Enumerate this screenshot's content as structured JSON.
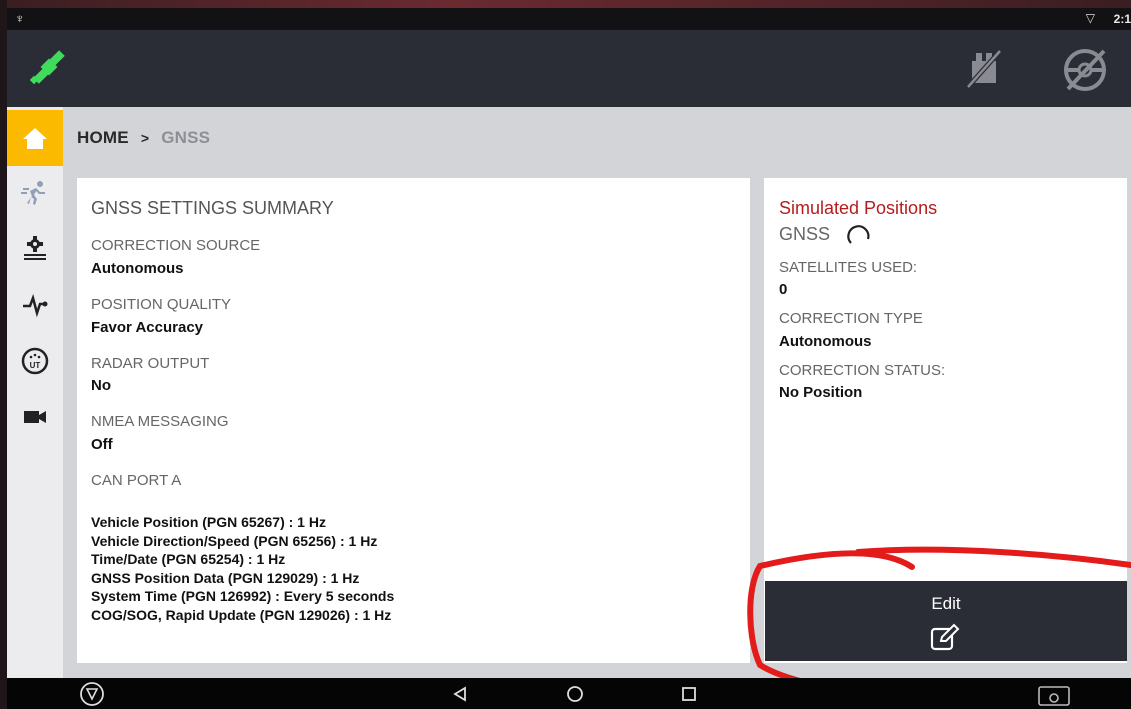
{
  "status_bar": {
    "time": "2:1"
  },
  "breadcrumb": {
    "home": "HOME",
    "separator": ">",
    "current": "GNSS"
  },
  "sidebar": {
    "items": [
      {
        "icon": "home-icon",
        "active": true
      },
      {
        "icon": "runner-icon",
        "active": false
      },
      {
        "icon": "field-gear-icon",
        "active": false
      },
      {
        "icon": "pulse-icon",
        "active": false
      },
      {
        "icon": "ut-icon",
        "active": false
      },
      {
        "icon": "camera-icon",
        "active": false
      }
    ]
  },
  "summary": {
    "title": "GNSS SETTINGS SUMMARY",
    "fields": [
      {
        "label": "CORRECTION SOURCE",
        "value": "Autonomous"
      },
      {
        "label": "POSITION QUALITY",
        "value": "Favor Accuracy"
      },
      {
        "label": "RADAR OUTPUT",
        "value": "No"
      },
      {
        "label": "NMEA MESSAGING",
        "value": "Off"
      }
    ],
    "can_port_label": "CAN PORT A",
    "can_messages": [
      "Vehicle Position (PGN 65267) : 1 Hz",
      "Vehicle Direction/Speed (PGN 65256) : 1 Hz",
      "Time/Date (PGN 65254) : 1 Hz",
      "GNSS Position Data (PGN 129029) : 1 Hz",
      "System Time (PGN 126992) : Every 5 seconds",
      "COG/SOG, Rapid Update (PGN 129026) : 1 Hz"
    ]
  },
  "status_panel": {
    "title": "Simulated Positions",
    "subtitle": "GNSS",
    "fields": [
      {
        "label": "SATELLITES USED:",
        "value": "0"
      },
      {
        "label": "CORRECTION TYPE",
        "value": "Autonomous"
      },
      {
        "label": "CORRECTION STATUS:",
        "value": "No Position"
      }
    ]
  },
  "edit_button": {
    "label": "Edit"
  },
  "colors": {
    "accent": "#fbb900",
    "header": "#2a2c36",
    "alert_title": "#b71c1c",
    "gps_green": "#3ddc5a",
    "annotation": "#e31b1b"
  }
}
